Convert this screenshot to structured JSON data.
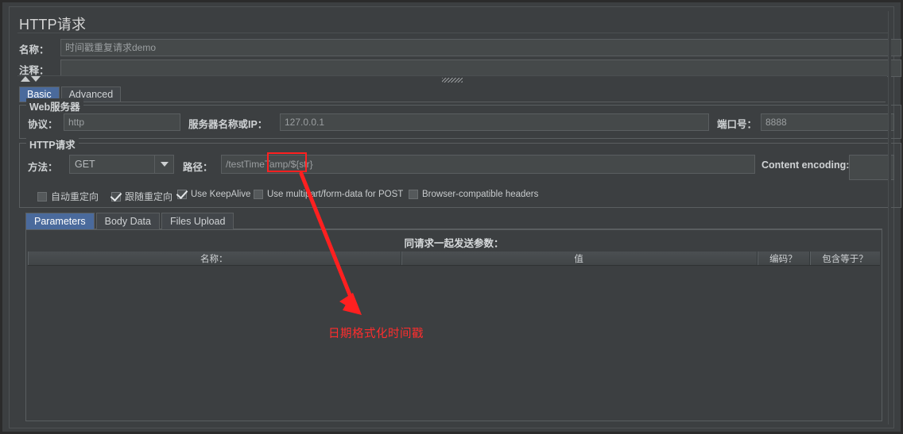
{
  "panel": {
    "title": "HTTP请求"
  },
  "header": {
    "name_label": "名称：",
    "name_value": "时间戳重复请求demo",
    "comment_label": "注释：",
    "comment_value": ""
  },
  "main_tabs": [
    {
      "label": "Basic",
      "selected": true
    },
    {
      "label": "Advanced",
      "selected": false
    }
  ],
  "web_server": {
    "group_title": "Web服务器",
    "protocol_label": "协议：",
    "protocol_value": "http",
    "host_label": "服务器名称或IP：",
    "host_value": "127.0.0.1",
    "port_label": "端口号：",
    "port_value": "8888"
  },
  "http_request": {
    "group_title": "HTTP请求",
    "method_label": "方法：",
    "method_value": "GET",
    "method_arrow_icon": "chevron-down-icon",
    "path_label": "路径：",
    "path_value": "/testTimeTamp/${str}",
    "content_encoding_label": "Content encoding:",
    "content_encoding_value": "",
    "checkboxes": [
      {
        "label": "自动重定向",
        "checked": false
      },
      {
        "label": "跟随重定向",
        "checked": true
      },
      {
        "label": "Use KeepAlive",
        "checked": true
      },
      {
        "label": "Use multipart/form-data for POST",
        "checked": false
      },
      {
        "label": "Browser-compatible headers",
        "checked": false
      }
    ]
  },
  "sub_tabs": [
    {
      "label": "Parameters",
      "selected": true
    },
    {
      "label": "Body Data",
      "selected": false
    },
    {
      "label": "Files Upload",
      "selected": false
    }
  ],
  "parameters": {
    "caption": "同请求一起发送参数：",
    "columns": [
      "名称：",
      "值",
      "编码？",
      "包含等于？"
    ],
    "rows": []
  },
  "annotations": {
    "highlight_box": "${str}",
    "callout_text": "日期格式化时间戳",
    "accent_color": "#ff2020"
  },
  "splitter": {
    "up_icon": "triangle-up-icon",
    "down_icon": "triangle-down-icon",
    "grip_icon": "grip-dots-icon"
  }
}
